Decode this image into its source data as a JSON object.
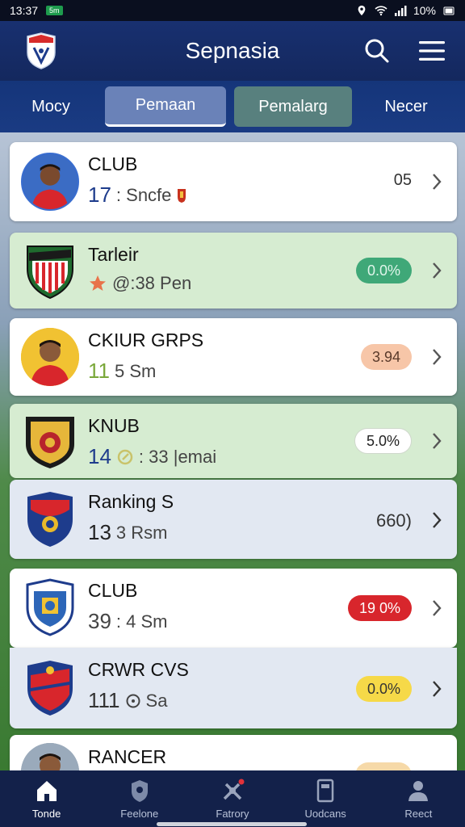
{
  "status_bar": {
    "time": "13:37",
    "badge": "5m",
    "battery": "10%"
  },
  "header": {
    "title": "Sepnasia",
    "colors": {
      "bg": "#183070"
    }
  },
  "tabs": [
    {
      "label": "Mocy"
    },
    {
      "label": "Pemaan"
    },
    {
      "label": "Pemalarg"
    },
    {
      "label": "Necer"
    }
  ],
  "rows": [
    {
      "title": "CLUB",
      "number": "17",
      "sub": ": Sncfe",
      "value": "05",
      "kind": "player",
      "bg": "white",
      "icon": "player-avatar"
    },
    {
      "title": "Tarleir",
      "number": "",
      "sub": "@:38 Pen",
      "value": "0.0%",
      "kind": "crest",
      "bg": "green",
      "pill_color": "#3fa878",
      "pill_text": "#dff5ea",
      "icon": "club-crest"
    },
    {
      "title": "CKIUR GRPS",
      "number": "11",
      "sub": "5 Sm",
      "value": "3.94",
      "kind": "player",
      "bg": "white",
      "pill_color": "#f7c6a8",
      "pill_text": "#5a3a2a",
      "icon": "player-avatar"
    },
    {
      "title": "KNUB",
      "number": "14",
      "sub": ": 33 |emai",
      "value": "5.0%",
      "kind": "crest",
      "bg": "green",
      "pill_color": "#ffffff",
      "pill_text": "#222222",
      "icon": "club-crest"
    },
    {
      "title": "Ranking S",
      "number": "13",
      "sub": "3 Rsm",
      "value": "660)",
      "kind": "crest",
      "bg": "blue",
      "icon": "club-crest"
    },
    {
      "title": "CLUB",
      "number": "39",
      "sub": ": 4 Sm",
      "value": "19 0%",
      "kind": "crest",
      "bg": "white",
      "pill_color": "#d8262c",
      "pill_text": "#ffffff",
      "icon": "club-crest"
    },
    {
      "title": "CRWR CVS",
      "number": "111",
      "sub": "Sa",
      "value": "0.0%",
      "kind": "crest",
      "bg": "blue",
      "pill_color": "#f6d948",
      "pill_text": "#333333",
      "icon": "club-crest"
    },
    {
      "title": "RANCER",
      "number": "",
      "sub": "",
      "value": "",
      "kind": "player",
      "bg": "white",
      "icon": "player-avatar"
    }
  ],
  "bottom_nav": [
    {
      "label": "Tonde",
      "icon": "home-icon",
      "active": true
    },
    {
      "label": "Feelone",
      "icon": "shield-icon",
      "active": false
    },
    {
      "label": "Fatrory",
      "icon": "tools-icon",
      "active": false
    },
    {
      "label": "Uodcans",
      "icon": "document-icon",
      "active": false
    },
    {
      "label": "Reect",
      "icon": "person-icon",
      "active": false
    }
  ]
}
